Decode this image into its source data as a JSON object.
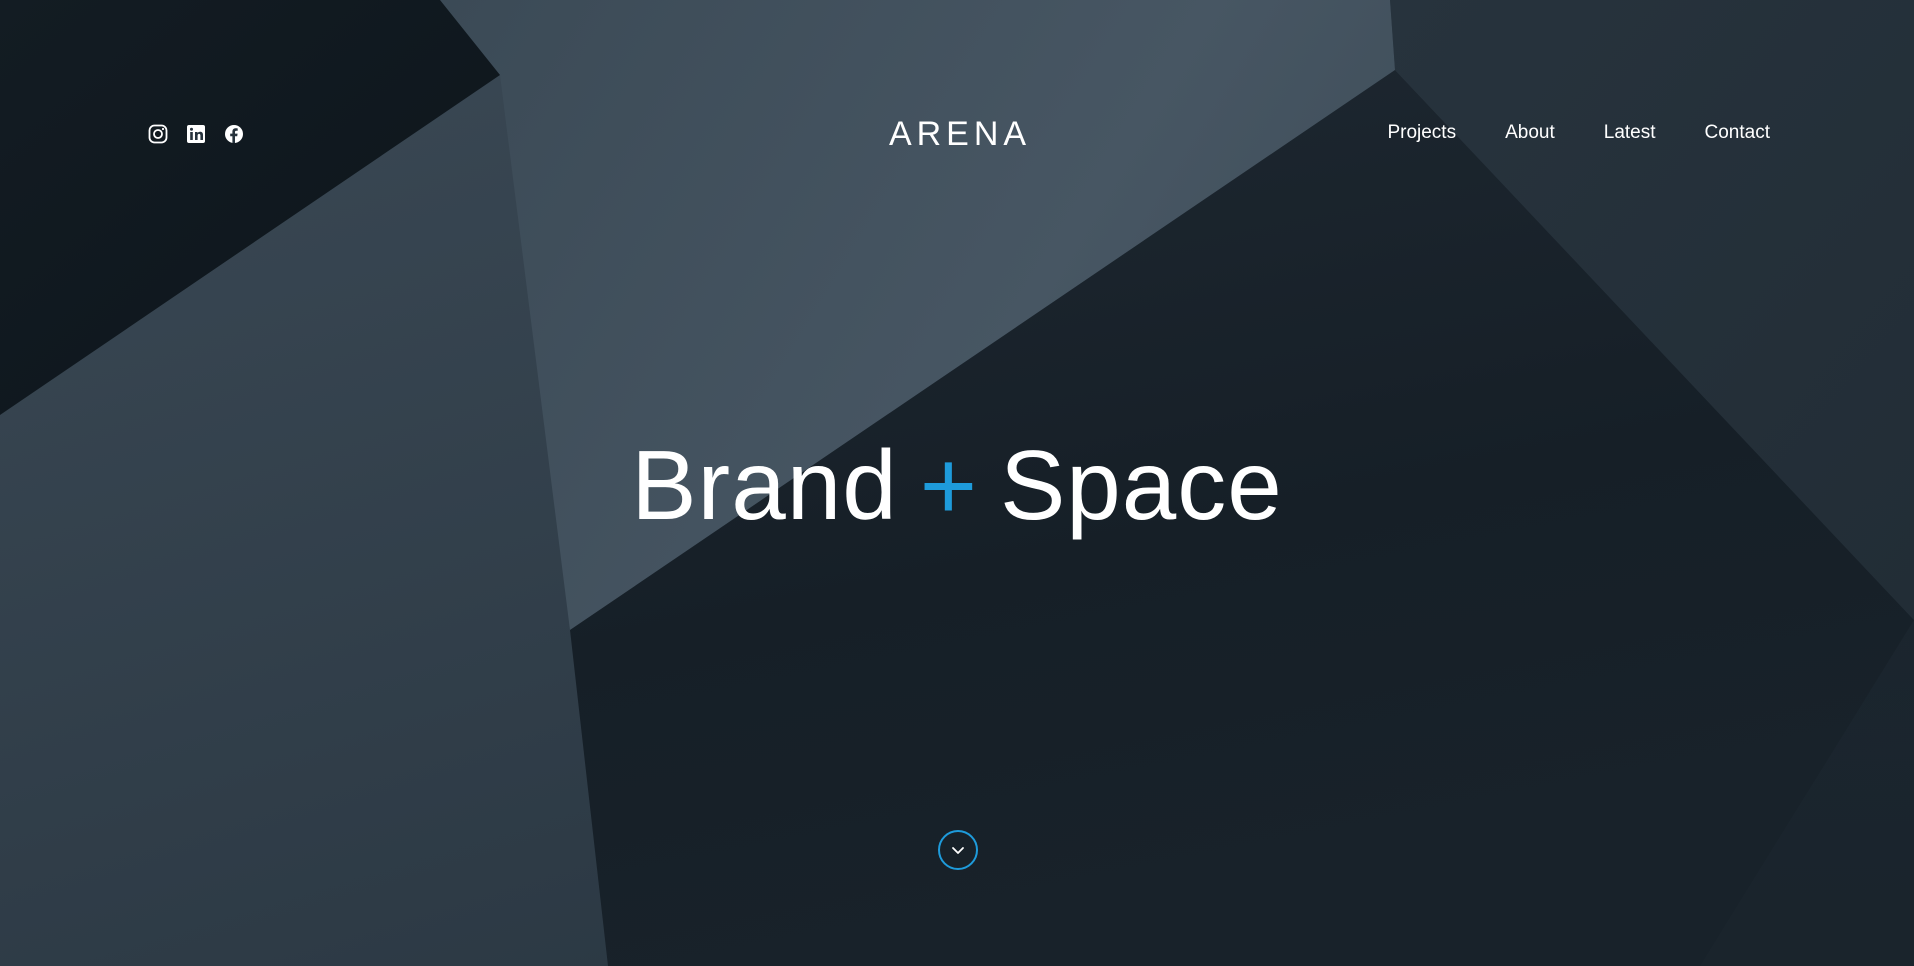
{
  "brand": {
    "logo_text": "ARENA",
    "accent_color": "#1e9bdb"
  },
  "social": [
    {
      "name": "Instagram",
      "icon": "instagram-icon"
    },
    {
      "name": "LinkedIn",
      "icon": "linkedin-icon"
    },
    {
      "name": "Facebook",
      "icon": "facebook-icon"
    }
  ],
  "nav": {
    "items": [
      {
        "label": "Projects"
      },
      {
        "label": "About"
      },
      {
        "label": "Latest"
      },
      {
        "label": "Contact"
      }
    ]
  },
  "hero": {
    "headline_left": "Brand",
    "headline_plus": "+",
    "headline_right": "Space",
    "scroll_icon": "chevron-down-icon"
  }
}
